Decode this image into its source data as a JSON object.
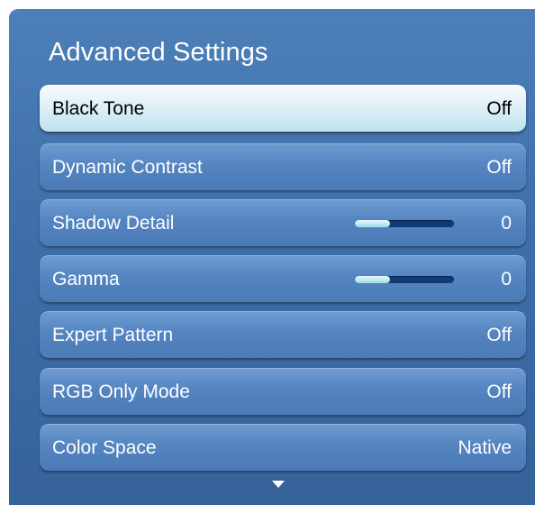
{
  "menu": {
    "title": "Advanced Settings",
    "items": [
      {
        "label": "Black Tone",
        "value": "Off"
      },
      {
        "label": "Dynamic Contrast",
        "value": "Off"
      },
      {
        "label": "Shadow Detail",
        "value": "0",
        "slider_level": 0.35
      },
      {
        "label": "Gamma",
        "value": "0",
        "slider_level": 0.35
      },
      {
        "label": "Expert Pattern",
        "value": "Off"
      },
      {
        "label": "RGB Only Mode",
        "value": "Off"
      },
      {
        "label": "Color Space",
        "value": "Native"
      }
    ],
    "scroll_icon": "chevron-down-icon"
  }
}
